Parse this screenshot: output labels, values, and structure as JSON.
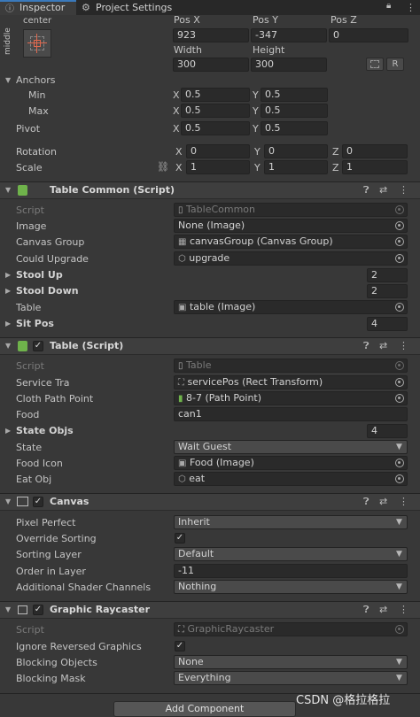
{
  "tabs": {
    "inspector": "Inspector",
    "project_settings": "Project Settings"
  },
  "rect": {
    "anchor_top": "center",
    "anchor_side": "middle",
    "posx_label": "Pos X",
    "posy_label": "Pos Y",
    "posz_label": "Pos Z",
    "posx": "923",
    "posy": "-347",
    "posz": "0",
    "width_label": "Width",
    "height_label": "Height",
    "width": "300",
    "height": "300",
    "r_button": "R",
    "anchors_label": "Anchors",
    "min_label": "Min",
    "max_label": "Max",
    "min_x": "0.5",
    "min_y": "0.5",
    "max_x": "0.5",
    "max_y": "0.5",
    "pivot_label": "Pivot",
    "pivot_x": "0.5",
    "pivot_y": "0.5",
    "rotation_label": "Rotation",
    "rot_x": "0",
    "rot_y": "0",
    "rot_z": "0",
    "scale_label": "Scale",
    "scale_x": "1",
    "scale_y": "1",
    "scale_z": "1",
    "axis_x": "X",
    "axis_y": "Y",
    "axis_z": "Z"
  },
  "table_common": {
    "title": "Table Common (Script)",
    "script_label": "Script",
    "script_value": "TableCommon",
    "image_label": "Image",
    "image_value": "None (Image)",
    "canvas_group_label": "Canvas Group",
    "canvas_group_value": "canvasGroup (Canvas Group)",
    "could_upgrade_label": "Could Upgrade",
    "could_upgrade_value": "upgrade",
    "stool_up_label": "Stool Up",
    "stool_up_value": "2",
    "stool_down_label": "Stool Down",
    "stool_down_value": "2",
    "table_label": "Table",
    "table_value": "table (Image)",
    "sit_pos_label": "Sit Pos",
    "sit_pos_value": "4"
  },
  "table_script": {
    "title": "Table (Script)",
    "script_label": "Script",
    "script_value": "Table",
    "service_label": "Service Tra",
    "service_value": "servicePos (Rect Transform)",
    "cloth_label": "Cloth Path Point",
    "cloth_value": "8-7 (Path Point)",
    "food_label": "Food",
    "food_value": "can1",
    "state_objs_label": "State Objs",
    "state_objs_value": "4",
    "state_label": "State",
    "state_value": "Wait Guest",
    "food_icon_label": "Food Icon",
    "food_icon_value": "Food (Image)",
    "eat_obj_label": "Eat Obj",
    "eat_obj_value": "eat"
  },
  "canvas": {
    "title": "Canvas",
    "pixel_perfect_label": "Pixel Perfect",
    "pixel_perfect_value": "Inherit",
    "override_sorting_label": "Override Sorting",
    "sorting_layer_label": "Sorting Layer",
    "sorting_layer_value": "Default",
    "order_label": "Order in Layer",
    "order_value": "-11",
    "shader_label": "Additional Shader Channels",
    "shader_value": "Nothing"
  },
  "raycaster": {
    "title": "Graphic Raycaster",
    "script_label": "Script",
    "script_value": "GraphicRaycaster",
    "ignore_label": "Ignore Reversed Graphics",
    "blocking_objects_label": "Blocking Objects",
    "blocking_objects_value": "None",
    "blocking_mask_label": "Blocking Mask",
    "blocking_mask_value": "Everything"
  },
  "add_component": "Add Component",
  "watermark": "CSDN @格拉格拉"
}
